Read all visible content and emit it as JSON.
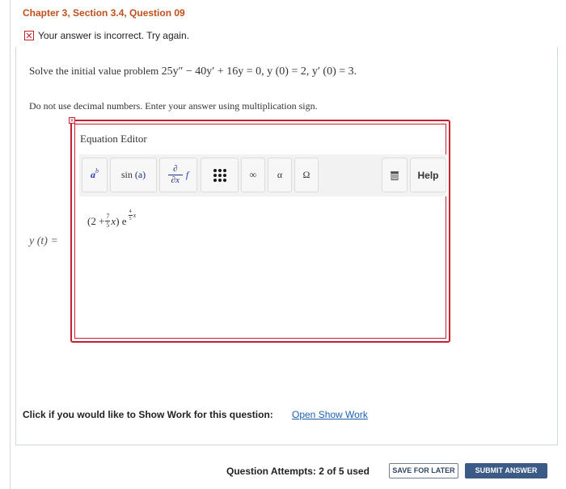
{
  "header": {
    "title": "Chapter 3, Section 3.4, Question 09"
  },
  "feedback": {
    "message": "Your answer is incorrect.  Try again."
  },
  "question": {
    "prefix": "Solve the initial value problem ",
    "equation": "25y″ − 40y′ + 16y = 0, y (0) = 2, y′ (0) = 3.",
    "instruction": "Do not use decimal numbers. Enter your answer using multiplication sign."
  },
  "answer": {
    "label": "y (t) =",
    "expr_open": "(2 + ",
    "frac1_num": "7",
    "frac1_den": "5",
    "expr_var": "x",
    "expr_close": ") e",
    "exp_num": "4",
    "exp_den": "5",
    "exp_var": "x"
  },
  "editor": {
    "title": "Equation Editor",
    "toolbar": {
      "superscript": "a",
      "superscript_exp": "b",
      "sin_func": "sin",
      "sin_arg": "(a)",
      "deriv_num": "∂",
      "deriv_den": "∂x",
      "deriv_f": "f",
      "infinity": "∞",
      "alpha": "α",
      "omega": "Ω",
      "help": "Help"
    }
  },
  "footer": {
    "show_work_prompt": "Click if you would like to Show Work for this question:",
    "show_work_link": "Open Show Work",
    "attempts": "Question Attempts: 2 of 5 used",
    "save_label": "SAVE FOR LATER",
    "submit_label": "SUBMIT ANSWER"
  },
  "colors": {
    "title": "#c0501b",
    "error": "#c8202d",
    "link": "#1f5fb0",
    "submit_bg": "#3b5a86"
  }
}
